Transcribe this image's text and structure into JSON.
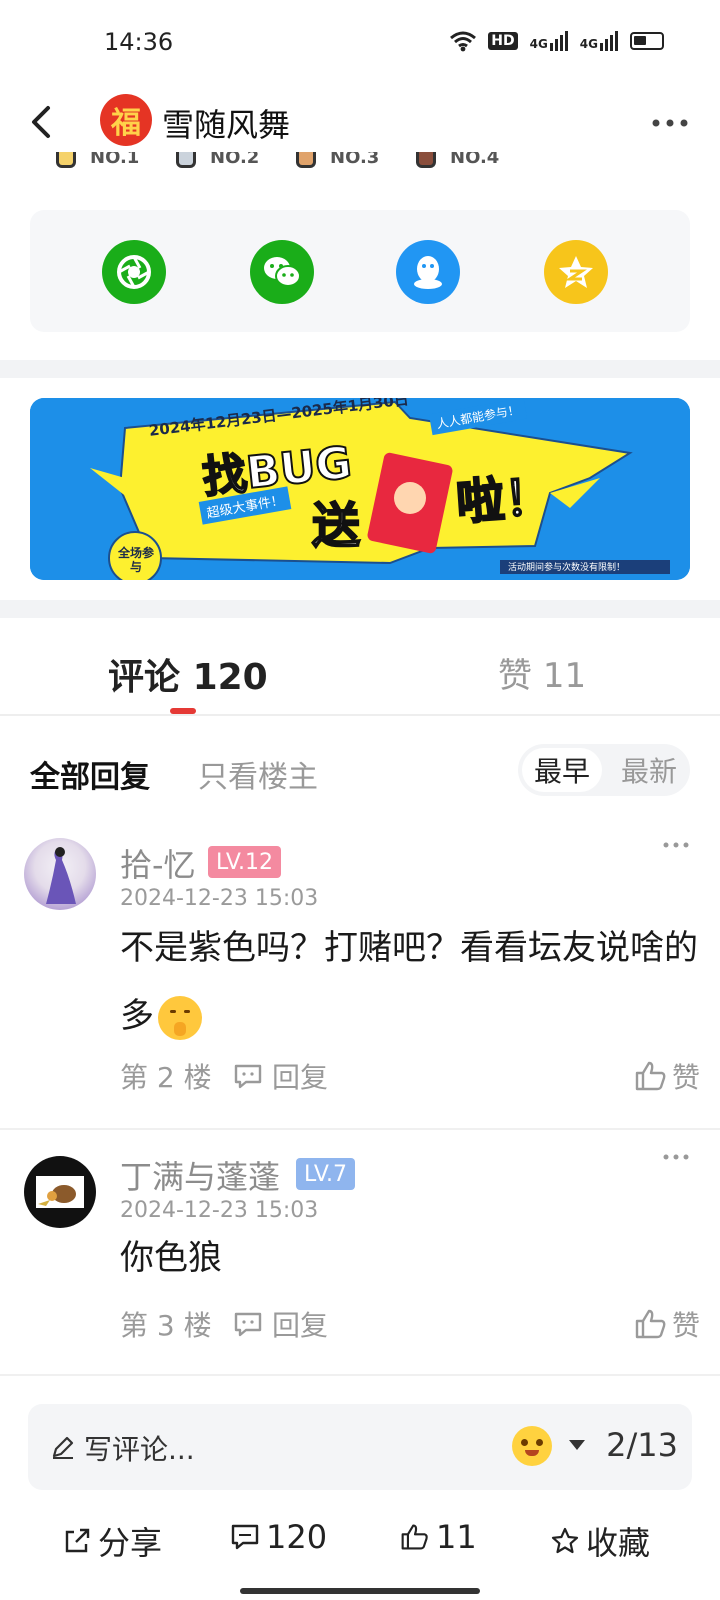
{
  "status": {
    "time": "14:36",
    "hd_label": "HD",
    "net1": "4G",
    "net2": "4G"
  },
  "nav": {
    "title": "雪随风舞",
    "avatar_char": "福"
  },
  "ranks": [
    "NO.1",
    "NO.2",
    "NO.3",
    "NO.4"
  ],
  "share_targets": [
    {
      "name": "moments-icon",
      "color": "#1aad19"
    },
    {
      "name": "wechat-icon",
      "color": "#1aad19"
    },
    {
      "name": "qq-icon",
      "color": "#2196f3"
    },
    {
      "name": "qzone-icon",
      "color": "#f7c51b"
    }
  ],
  "banner": {
    "date_range": "2024年12月23日—2025年1月30日",
    "headline_1": "找BUG",
    "headline_2": "送",
    "headline_3": "啦！",
    "tag_all": "人人都能参与！",
    "tag_super": "超级大事件！",
    "badge": "全场参与",
    "note": "活动期间参与次数没有限制！"
  },
  "tabs": {
    "comments_label": "评论",
    "comments_count": "120",
    "likes_label": "赞",
    "likes_count": "11"
  },
  "filter": {
    "all": "全部回复",
    "owner_only": "只看楼主",
    "sort_early": "最早",
    "sort_new": "最新"
  },
  "comments": [
    {
      "name": "拾-忆",
      "level": "LV.12",
      "level_color": "#f48aa0",
      "time": "2024-12-23 15:03",
      "text": "不是紫色吗？打赌吧？看看坛友说啥的多",
      "floor": "第 2 楼",
      "reply": "回复",
      "like": "赞"
    },
    {
      "name": "丁满与蓬蓬",
      "level": "LV.7",
      "level_color": "#8fb5ee",
      "time": "2024-12-23 15:03",
      "text": "你色狼",
      "floor": "第 3 楼",
      "reply": "回复",
      "like": "赞"
    }
  ],
  "input": {
    "placeholder": "写评论...",
    "page_counter": "2/13"
  },
  "actions": {
    "share": "分享",
    "comments": "120",
    "likes": "11",
    "favorite": "收藏"
  }
}
